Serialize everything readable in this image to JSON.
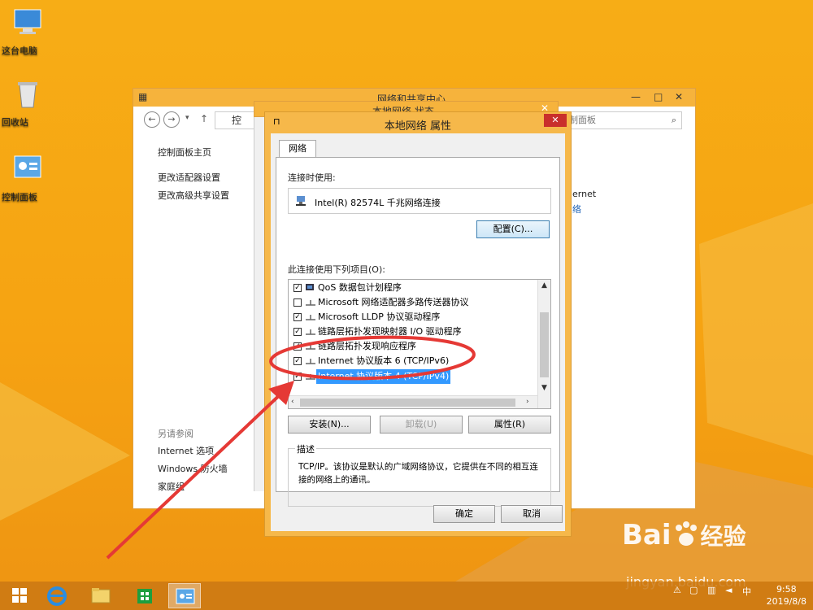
{
  "desktop": {
    "icons": [
      {
        "label": "这台电脑",
        "icon": "computer-icon"
      },
      {
        "label": "回收站",
        "icon": "recycle-bin-icon"
      },
      {
        "label": "控制面板",
        "icon": "control-panel-icon"
      }
    ]
  },
  "bg_window": {
    "title": "网络和共享中心",
    "breadcrumb": "控",
    "search_placeholder": "制面板",
    "sidebar_links": [
      "控制面板主页",
      "更改适配器设置",
      "更改高级共享设置"
    ],
    "see_also_heading": "另请参阅",
    "see_also_links": [
      "Internet 选项",
      "Windows 防火墙",
      "家庭组"
    ],
    "right_text_1": "ernet",
    "right_text_2": "络"
  },
  "mid_window": {
    "title": "本地网络 状态"
  },
  "dialog": {
    "title": "本地网络 属性",
    "tab_label": "网络",
    "connect_using_label": "连接时使用:",
    "adapter_name": "Intel(R) 82574L 千兆网络连接",
    "configure_button": "配置(C)...",
    "items_label": "此连接使用下列项目(O):",
    "items": [
      {
        "label": "QoS 数据包计划程序",
        "checked": true
      },
      {
        "label": "Microsoft 网络适配器多路传送器协议",
        "checked": false
      },
      {
        "label": "Microsoft LLDP 协议驱动程序",
        "checked": true
      },
      {
        "label": "链路层拓扑发现映射器 I/O 驱动程序",
        "checked": true
      },
      {
        "label": "链路层拓扑发现响应程序",
        "checked": true
      },
      {
        "label": "Internet 协议版本 6 (TCP/IPv6)",
        "checked": true
      },
      {
        "label": "Internet 协议版本 4 (TCP/IPv4)",
        "checked": true,
        "selected": true
      }
    ],
    "install_button": "安装(N)...",
    "uninstall_button": "卸载(U)",
    "properties_button": "属性(R)",
    "description_heading": "描述",
    "description_text": "TCP/IP。该协议是默认的广域网络协议，它提供在不同的相互连接的网络上的通讯。",
    "ok_button": "确定",
    "cancel_button": "取消"
  },
  "taskbar": {
    "tray_ime": "中",
    "time": "9:58",
    "date": "2019/8/8"
  },
  "watermark": {
    "brand": "Bai",
    "brand_suffix": "经验",
    "url": "jingyan.baidu.com"
  },
  "colors": {
    "wallpaper": "#f6a312",
    "selection": "#3399ff",
    "annotation": "#e53935"
  }
}
